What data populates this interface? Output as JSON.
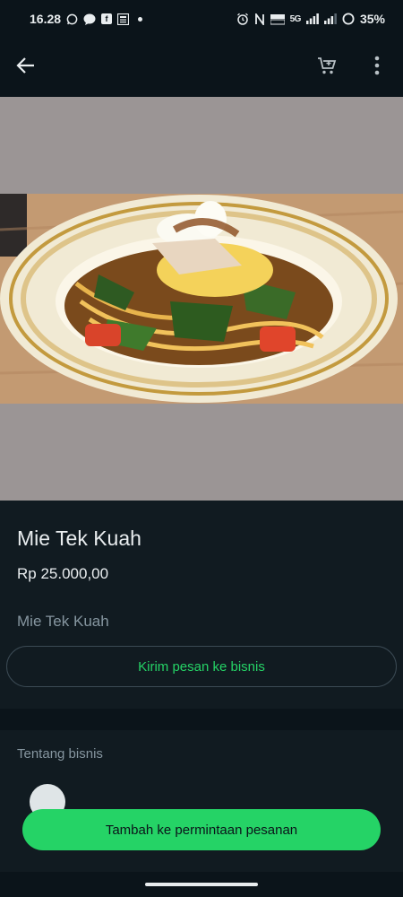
{
  "status_bar": {
    "time": "16.28",
    "network": "5G",
    "battery": "35%",
    "icons": [
      "whatsapp-icon",
      "chat-icon",
      "facebook-icon",
      "news-icon",
      "alarm-icon",
      "nfc-icon",
      "volte-icon",
      "signal-icon",
      "battery-icon"
    ]
  },
  "app_bar": {
    "icons": [
      "back-arrow-icon",
      "cart-icon",
      "more-vert-icon"
    ]
  },
  "product": {
    "name": "Mie Tek Kuah",
    "price": "Rp 25.000,00",
    "description": "Mie Tek Kuah",
    "send_message_label": "Kirim pesan ke bisnis"
  },
  "about": {
    "title": "Tentang bisnis"
  },
  "footer": {
    "add_order_label": "Tambah ke permintaan pesanan"
  },
  "colors": {
    "accent": "#25d366",
    "background": "#111b21",
    "bar": "#0b141a",
    "image_placeholder": "#9b9595"
  }
}
